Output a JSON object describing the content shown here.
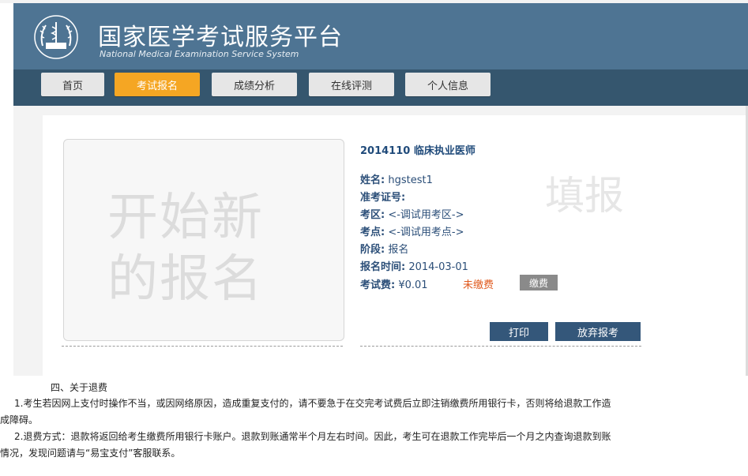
{
  "top_strip": {
    "cut_text": "…………"
  },
  "header": {
    "title_cn": "国家医学考试服务平台",
    "title_en": "National Medical Examination Service System",
    "emblem_text": "全国医学考试"
  },
  "nav": [
    {
      "label": "首页",
      "active": false
    },
    {
      "label": "考试报名",
      "active": true
    },
    {
      "label": "成绩分析",
      "active": false
    },
    {
      "label": "在线评测",
      "active": false
    },
    {
      "label": "个人信息",
      "active": false
    }
  ],
  "new_registration": {
    "line1": "开始新",
    "line2": "的报名"
  },
  "registration": {
    "exam_title": "2014110 临床执业医师",
    "name_label": "姓名:",
    "name_value": "hgstest1",
    "ticket_label": "准考证号:",
    "ticket_value": "",
    "area_label": "考区:",
    "area_value": "<-调试用考区->",
    "site_label": "考点:",
    "site_value": "<-调试用考点->",
    "stage_label": "阶段:",
    "stage_value": "报名",
    "time_label": "报名时间:",
    "time_value": "2014-03-01",
    "fee_label": "考试费:",
    "fee_value": "¥0.01",
    "fee_status": "未缴费",
    "pay_button": "缴费",
    "watermark": "填报",
    "print_button": "打印",
    "abandon_button": "放弃报考"
  },
  "document": {
    "heading": "四、关于退费",
    "p1_line1": "1.考生若因网上支付时操作不当，或因网络原因，造成重复支付的，请不要急于在交完考试费后立即注销缴费所用银行卡，否则将给退款工作造",
    "p1_line2": "成障碍。",
    "p2_line1": "2.退费方式：退款将返回给考生缴费所用银行卡账户。退款到账通常半个月左右时间。因此，考生可在退款工作完毕后一个月之内查询退款到账",
    "p2_line2": "情况，发现问题请与“易宝支付”客服联系。"
  },
  "colors": {
    "header": "#4e7493",
    "nav_band": "#35566e",
    "active_tab": "#f5a623",
    "action_button": "#34577a",
    "fee_status": "#e05a1e",
    "info_text": "#2b4e78"
  }
}
